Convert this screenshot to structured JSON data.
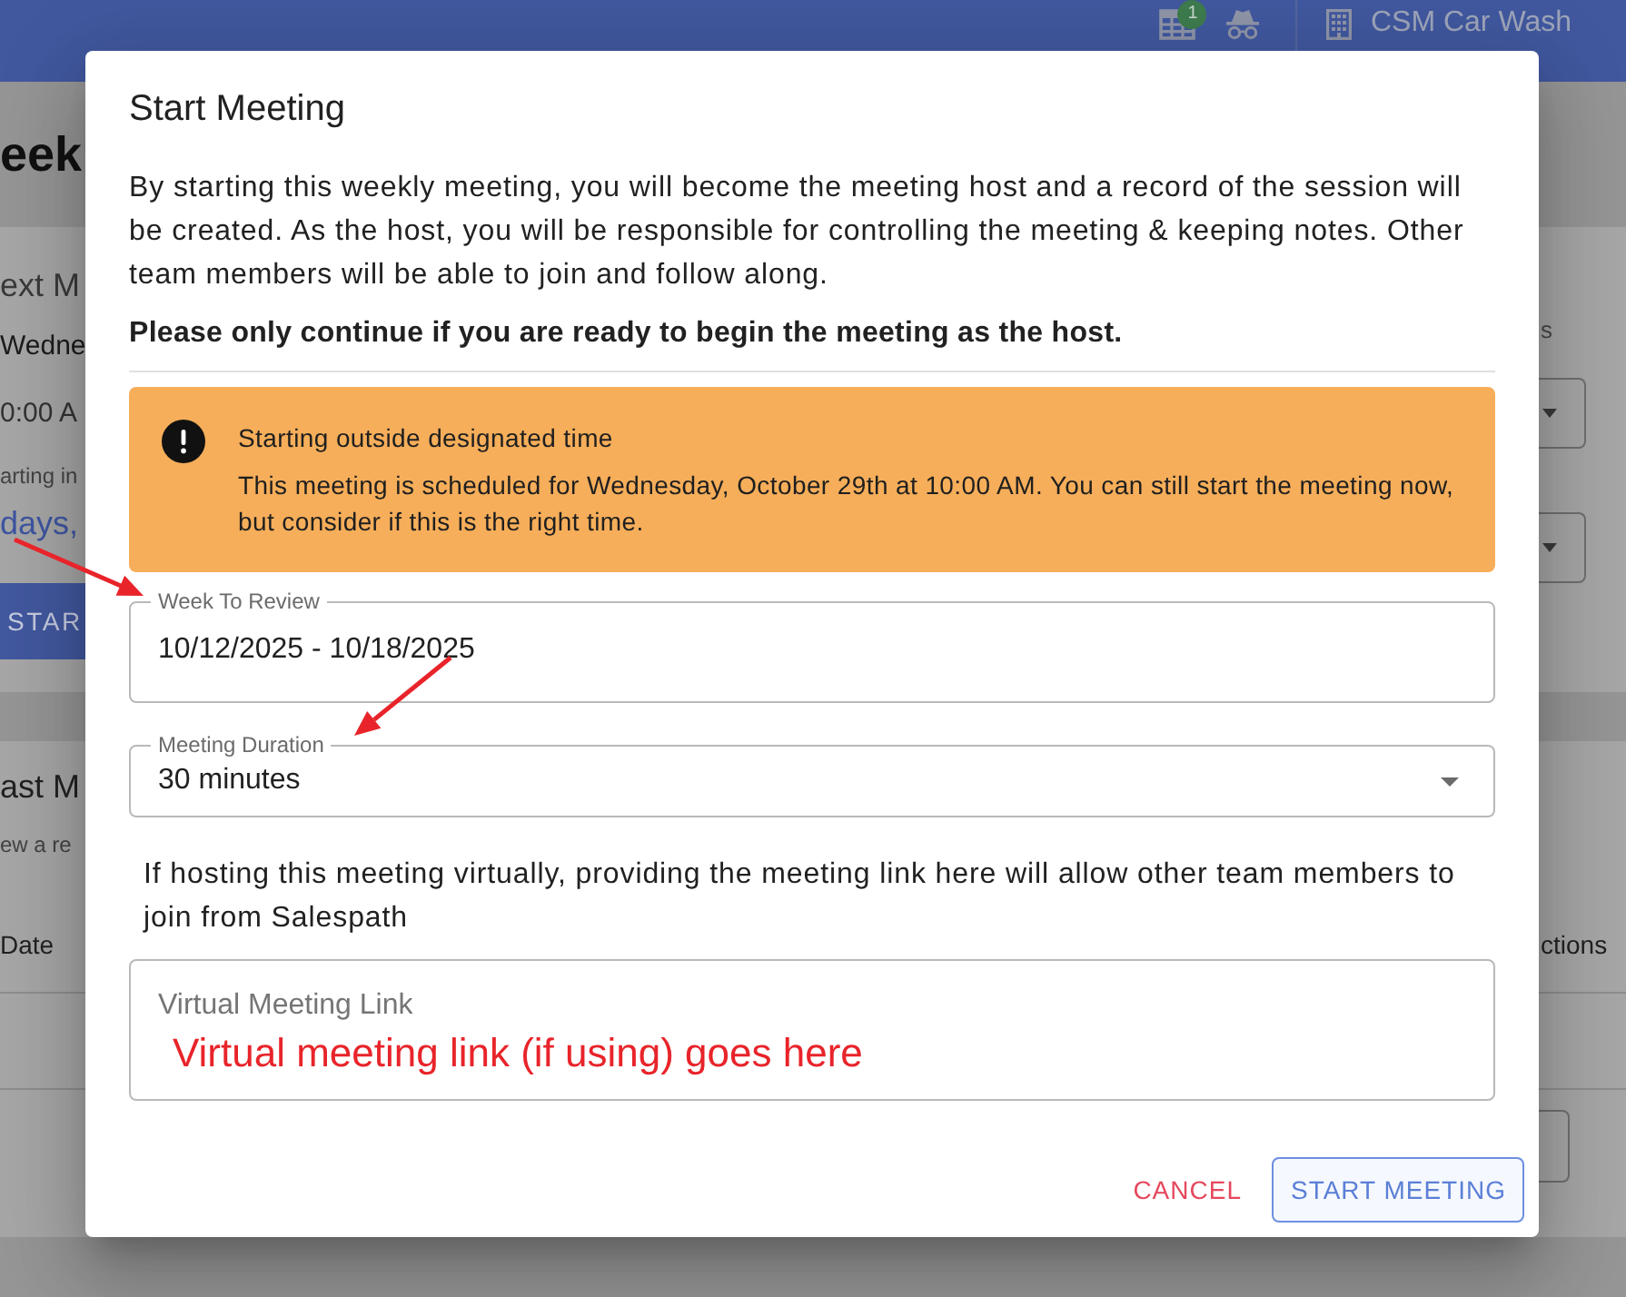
{
  "top_bar": {
    "notification_count": "1",
    "organization": "CSM Car Wash"
  },
  "background_page": {
    "heading": "eek",
    "next_meeting": {
      "title": "ext M",
      "day": "Wedne",
      "time": "0:00 A",
      "countdown_label": "arting in",
      "countdown": "days,",
      "start_button": "STAR",
      "dropdown_label": "s"
    },
    "past_meetings": {
      "title": "ast M",
      "subtitle": "ew a re",
      "columns": [
        "Date",
        "ctions"
      ]
    }
  },
  "dialog": {
    "title": "Start Meeting",
    "description": "By starting this weekly meeting, you will become the meeting host and a record of the session will be created. As the host, you will be responsible for controlling the meeting & keeping notes. Other team members will be able to join and follow along.",
    "notice": "Please only continue if you are ready to begin the meeting as the host.",
    "alert": {
      "title": "Starting outside designated time",
      "message": "This meeting is scheduled for Wednesday, October 29th at 10:00 AM. You can still start the meeting now, but consider if this is the right time."
    },
    "week_field": {
      "label": "Week To Review",
      "value": "10/12/2025 - 10/18/2025"
    },
    "duration_field": {
      "label": "Meeting Duration",
      "value": "30 minutes"
    },
    "link_help": "If hosting this meeting virtually, providing the meeting link here will allow other team members to join from Salespath",
    "link_field": {
      "placeholder": "Virtual Meeting Link"
    },
    "cancel_button": "CANCEL",
    "start_button": "START MEETING"
  },
  "annotation": {
    "note": "Virtual meeting link (if using) goes here"
  }
}
